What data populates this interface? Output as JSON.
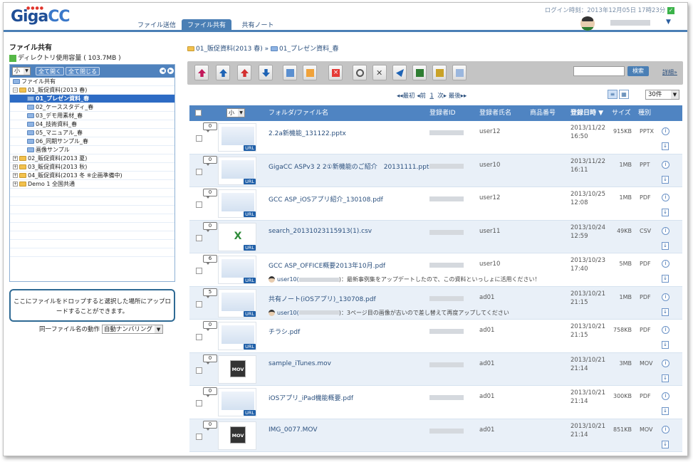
{
  "app": {
    "logo_main": "Giga",
    "logo_accent": "CC",
    "logo_dots": "●●●●"
  },
  "nav": {
    "tabs": [
      {
        "label": "ファイル送信",
        "active": false
      },
      {
        "label": "ファイル共有",
        "active": true
      },
      {
        "label": "共有ノート",
        "active": false
      }
    ]
  },
  "login": {
    "text": "ログイン時刻：2013年12月05日 17時23分",
    "check": "✓"
  },
  "user": {
    "menu_arrow": "▼"
  },
  "sidebar": {
    "title": "ファイル共有",
    "usage": "ディレクトリ使用容量 ( 103.7MB )",
    "size_select": "小",
    "expand_all": "全て開く",
    "collapse_all": "全て閉じる",
    "tree": [
      {
        "label": "ファイル共有",
        "level": 0,
        "icon": "share-root-icon"
      },
      {
        "label": "01_販促資料(2013 春)",
        "level": 0,
        "expander": "−"
      },
      {
        "label": "01_プレゼン資料_春",
        "level": 1,
        "selected": true
      },
      {
        "label": "02_ケーススタディ_春",
        "level": 1
      },
      {
        "label": "03_デモ用素材_春",
        "level": 1
      },
      {
        "label": "04_技術資料_春",
        "level": 1
      },
      {
        "label": "05_マニュアル_春",
        "level": 1
      },
      {
        "label": "06_同期サンプル_春",
        "level": 1
      },
      {
        "label": "画像サンプル",
        "level": 1
      },
      {
        "label": "02_販促資料(2013 夏)",
        "level": 0,
        "expander": "+"
      },
      {
        "label": "03_販促資料(2013 秋)",
        "level": 0,
        "expander": "+"
      },
      {
        "label": "04_販促資料(2013 冬 ※企画準備中)",
        "level": 0,
        "expander": "+"
      },
      {
        "label": "Demo 1 全国共通",
        "level": 0,
        "expander": "+"
      }
    ],
    "drop_hint": "ここにファイルをドロップすると選択した場所にアップロードすることができます。",
    "dup_label": "同一ファイル名の動作",
    "dup_value": "自動ナンバリング"
  },
  "breadcrumb": {
    "parent": "01_販促資料(2013 春)",
    "sep": "»",
    "current": "01_プレゼン資料_春"
  },
  "search": {
    "button": "検索",
    "detail": "詳細»"
  },
  "pager": {
    "first": "◂◂最初",
    "prev": "◂前",
    "page": "1",
    "next": "次▸",
    "last": "最後▸▸"
  },
  "per_page": "30件",
  "columns": {
    "size": "小",
    "name": "フォルダ/ファイル名",
    "owner_id": "登録者ID",
    "owner_name": "登録者氏名",
    "product": "商品番号",
    "date": "登録日時 ▼",
    "filesize": "サイズ",
    "type": "種別"
  },
  "files": [
    {
      "count": "0",
      "name": "2.2a新機能_131122.pptx",
      "user": "user12",
      "date1": "2013/11/22",
      "date2": "16:50",
      "size": "915KB",
      "type": "PPTX",
      "thumb": "doc"
    },
    {
      "count": "0",
      "name": "GigaCC ASPv3 2 2①新機能のご紹介　20131111.ppt",
      "user": "user10",
      "date1": "2013/11/22",
      "date2": "16:11",
      "size": "1MB",
      "type": "PPT",
      "thumb": "doc"
    },
    {
      "count": "0",
      "name": "GCC ASP_iOSアプリ紹介_130108.pdf",
      "user": "user12",
      "date1": "2013/10/25",
      "date2": "12:08",
      "size": "1MB",
      "type": "PDF",
      "thumb": "doc"
    },
    {
      "count": "0",
      "name": "search_20131023115913(1).csv",
      "user": "user11",
      "date1": "2013/10/24",
      "date2": "12:59",
      "size": "49KB",
      "type": "CSV",
      "thumb": "csv"
    },
    {
      "count": "6",
      "name": "GCC ASP_OFFICE概要2013年10月.pdf",
      "user": "user10",
      "date1": "2013/10/23",
      "date2": "17:40",
      "size": "5MB",
      "type": "PDF",
      "thumb": "doc",
      "comment_user": "user10(",
      "comment_text": ")：最新事例集をアップデートしたので、この資料といっしょに活用ください！"
    },
    {
      "count": "5",
      "name": "共有ノート(iOSアプリ)_130708.pdf",
      "user": "ad01",
      "date1": "2013/10/21",
      "date2": "21:15",
      "size": "1MB",
      "type": "PDF",
      "thumb": "doc",
      "comment_user": "user10(",
      "comment_text": ")：3ページ目の画像が古いので差し替えて再度アップしてください"
    },
    {
      "count": "0",
      "name": "チラシ.pdf",
      "user": "ad01",
      "date1": "2013/10/21",
      "date2": "21:15",
      "size": "758KB",
      "type": "PDF",
      "thumb": "doc"
    },
    {
      "count": "0",
      "name": "sample_iTunes.mov",
      "user": "ad01",
      "date1": "2013/10/21",
      "date2": "21:14",
      "size": "3MB",
      "type": "MOV",
      "thumb": "mov"
    },
    {
      "count": "0",
      "name": "iOSアプリ_iPad機能概要.pdf",
      "user": "ad01",
      "date1": "2013/10/21",
      "date2": "21:14",
      "size": "300KB",
      "type": "PDF",
      "thumb": "doc"
    },
    {
      "count": "0",
      "name": "IMG_0077.MOV",
      "user": "ad01",
      "date1": "2013/10/21",
      "date2": "21:14",
      "size": "851KB",
      "type": "MOV",
      "thumb": "mov"
    }
  ],
  "badges": {
    "url": "URL",
    "csv": "X",
    "mov": "MOV",
    "info": "i",
    "download": "↓"
  }
}
